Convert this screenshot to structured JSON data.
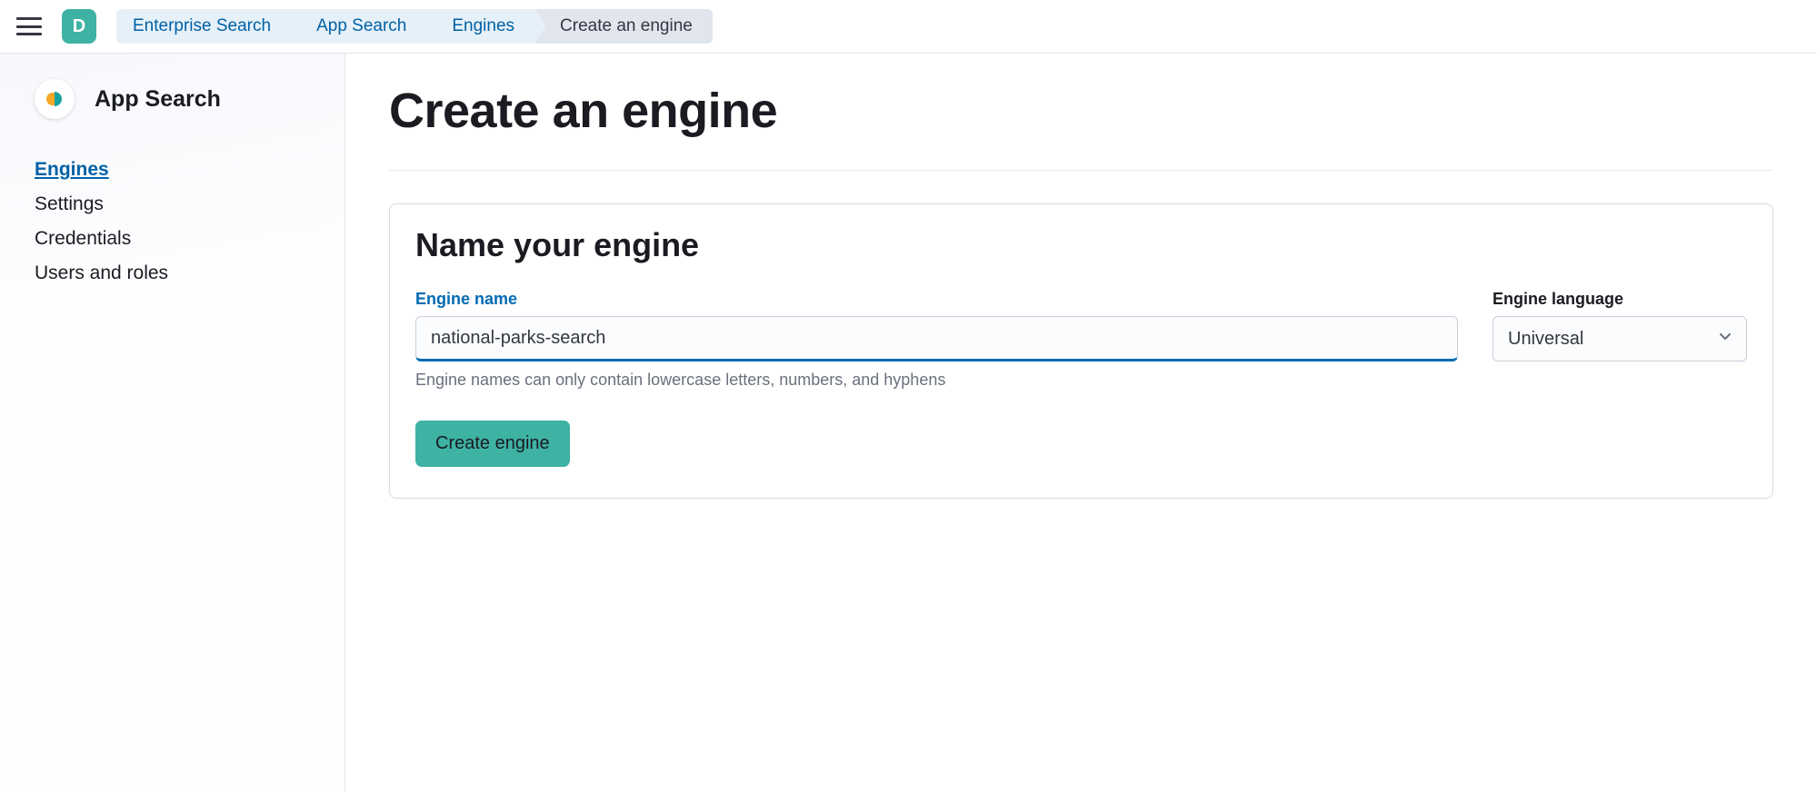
{
  "header": {
    "avatar_initial": "D",
    "breadcrumbs": [
      {
        "label": "Enterprise Search",
        "current": false
      },
      {
        "label": "App Search",
        "current": false
      },
      {
        "label": "Engines",
        "current": false
      },
      {
        "label": "Create an engine",
        "current": true
      }
    ]
  },
  "sidebar": {
    "title": "App Search",
    "items": [
      {
        "label": "Engines",
        "active": true
      },
      {
        "label": "Settings",
        "active": false
      },
      {
        "label": "Credentials",
        "active": false
      },
      {
        "label": "Users and roles",
        "active": false
      }
    ]
  },
  "main": {
    "page_title": "Create an engine",
    "panel_title": "Name your engine",
    "engine_name": {
      "label": "Engine name",
      "value": "national-parks-search",
      "help": "Engine names can only contain lowercase letters, numbers, and hyphens"
    },
    "engine_language": {
      "label": "Engine language",
      "selected": "Universal"
    },
    "submit_label": "Create engine"
  }
}
